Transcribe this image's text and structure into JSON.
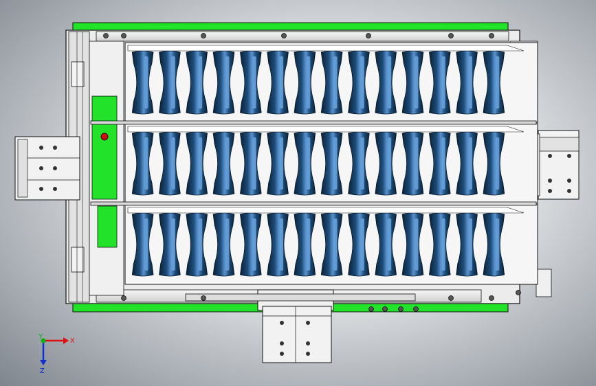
{
  "viewport": {
    "background": "gradient-grey",
    "triad": {
      "x_label": "X",
      "y_label": "Y",
      "z_label": "Z"
    }
  },
  "colors": {
    "frame_green": "#22e22a",
    "frame_outline": "#1a1a1a",
    "steel": "#e8e8e8",
    "cup_dark": "#0c2a44",
    "cup_mid": "#1f4f7a",
    "cup_light": "#4d88c6",
    "axis_x": "#e01010",
    "axis_y": "#10b010",
    "axis_z": "#1030d0"
  },
  "assembly": {
    "tray_rows": 3,
    "cups_per_row": 14,
    "row_separators": 2
  }
}
